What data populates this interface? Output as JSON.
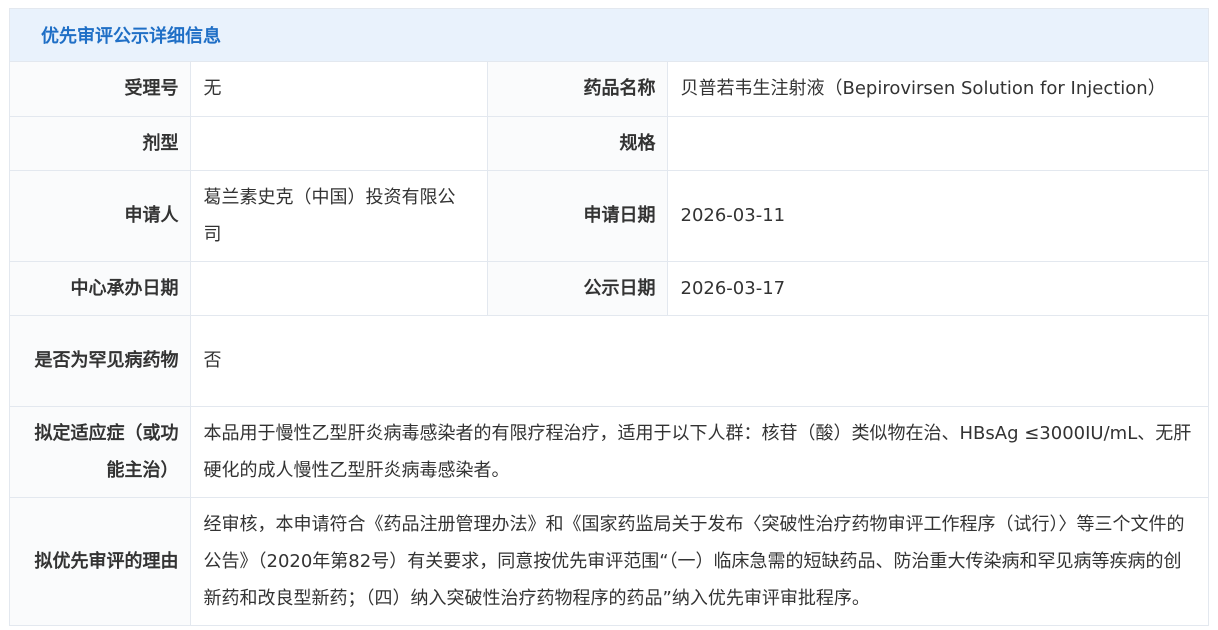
{
  "header": {
    "title": "优先审评公示详细信息"
  },
  "fields": {
    "acceptance_no": {
      "label": "受理号",
      "value": "无"
    },
    "drug_name": {
      "label": "药品名称",
      "value": "贝普若韦生注射液（Bepirovirsen Solution for Injection）"
    },
    "dosage_form": {
      "label": "剂型",
      "value": ""
    },
    "specification": {
      "label": "规格",
      "value": ""
    },
    "applicant": {
      "label": "申请人",
      "value": "葛兰素史克（中国）投资有限公司"
    },
    "application_date": {
      "label": "申请日期",
      "value": "2026-03-11"
    },
    "center_date": {
      "label": "中心承办日期",
      "value": ""
    },
    "publicity_date": {
      "label": "公示日期",
      "value": "2026-03-17"
    },
    "rare_disease": {
      "label": "是否为罕见病药物",
      "value": "否"
    },
    "indication": {
      "label": "拟定适应症（或功能主治）",
      "value": "本品用于慢性乙型肝炎病毒感染者的有限疗程治疗，适用于以下人群：核苷（酸）类似物在治、HBsAg ≤3000IU/mL、无肝硬化的成人慢性乙型肝炎病毒感染者。"
    },
    "priority_reason": {
      "label": "拟优先审评的理由",
      "value": "经审核，本申请符合《药品注册管理办法》和《国家药监局关于发布〈突破性治疗药物审评工作程序（试行）〉等三个文件的公告》（2020年第82号）有关要求，同意按优先审评范围“（一）临床急需的短缺药品、防治重大传染病和罕见病等疾病的创新药和改良型新药；（四）纳入突破性治疗药物程序的药品”纳入优先审评审批程序。"
    }
  }
}
